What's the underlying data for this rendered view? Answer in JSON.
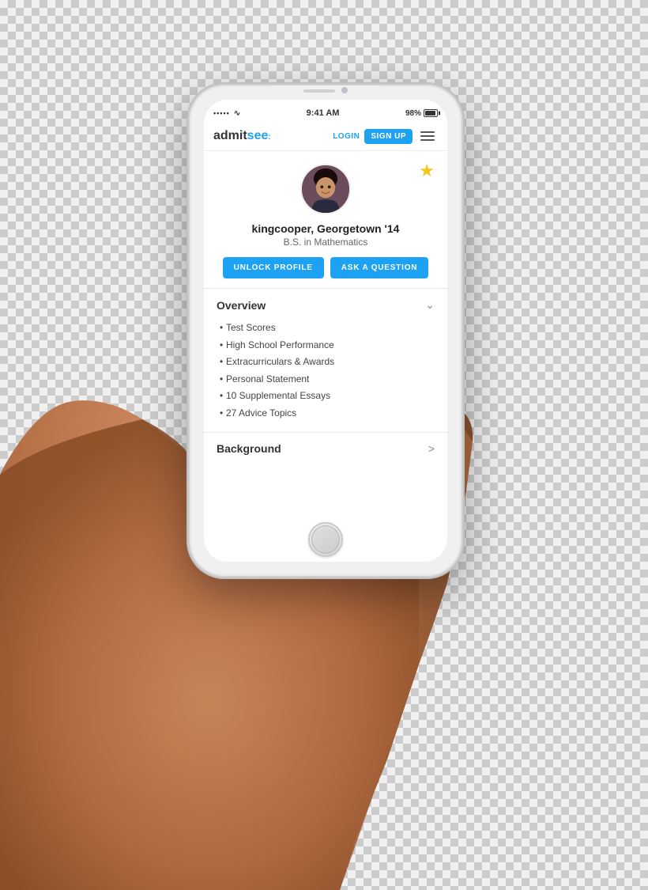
{
  "background": {
    "color": "#c9e8f0"
  },
  "phone": {
    "status_bar": {
      "signal": "•••••",
      "wifi": "WiFi",
      "time": "9:41 AM",
      "battery_pct": "98%"
    },
    "navbar": {
      "logo": "admitsee",
      "login_label": "LOGIN",
      "signup_label": "SIGN UP"
    },
    "profile": {
      "username": "kingcooper,",
      "school": "Georgetown '14",
      "degree": "B.S. in Mathematics",
      "unlock_label": "UNLOCK PROFILE",
      "ask_label": "ASK A QUESTION"
    },
    "overview": {
      "section_title": "Overview",
      "items": [
        "Test Scores",
        "High School Performance",
        "Extracurriculars & Awards",
        "Personal Statement",
        "10 Supplemental Essays",
        "27 Advice Topics"
      ]
    },
    "background_section": {
      "title": "Background"
    }
  }
}
